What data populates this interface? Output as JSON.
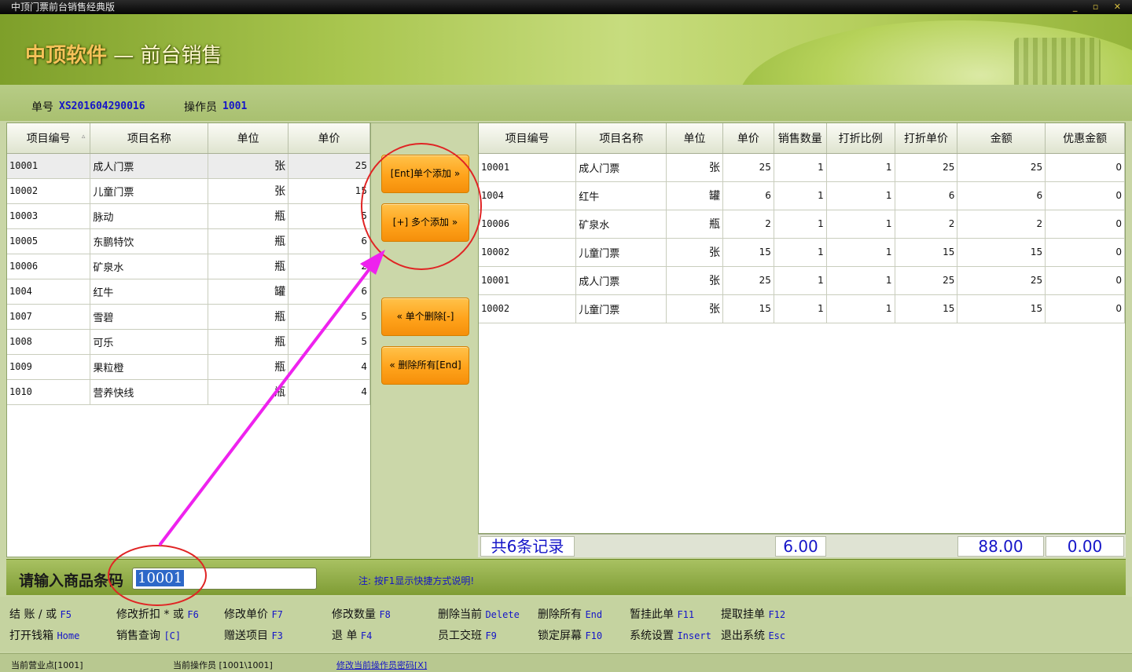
{
  "window": {
    "title": "中顶门票前台销售经典版",
    "controls": "_ ▫ ✕"
  },
  "banner": {
    "brand": "中顶软件",
    "dash": " — ",
    "subtitle": "前台销售"
  },
  "info": {
    "order_label": "单号",
    "order_no": "XS201604290016",
    "operator_label": "操作员",
    "operator_no": "1001"
  },
  "product_table": {
    "headers": [
      "项目编号",
      "项目名称",
      "单位",
      "单价"
    ],
    "rows": [
      [
        "10001",
        "成人门票",
        "张",
        "25"
      ],
      [
        "10002",
        "儿童门票",
        "张",
        "15"
      ],
      [
        "10003",
        "脉动",
        "瓶",
        "5"
      ],
      [
        "10005",
        "东鹏特饮",
        "瓶",
        "6"
      ],
      [
        "10006",
        "矿泉水",
        "瓶",
        "2"
      ],
      [
        "1004",
        "红牛",
        "罐",
        "6"
      ],
      [
        "1007",
        "雪碧",
        "瓶",
        "5"
      ],
      [
        "1008",
        "可乐",
        "瓶",
        "5"
      ],
      [
        "1009",
        "果粒橙",
        "瓶",
        "4"
      ],
      [
        "1010",
        "营养快线",
        "瓶",
        "4"
      ]
    ]
  },
  "buttons": {
    "add_one": "[Ent]单个添加 »",
    "add_multi": "[+] 多个添加 »",
    "delete_one": "« 单个删除[-]",
    "delete_all": "« 删除所有[End]"
  },
  "sale_table": {
    "headers": [
      "项目编号",
      "项目名称",
      "单位",
      "单价",
      "销售数量",
      "打折比例",
      "打折单价",
      "金额",
      "优惠金额"
    ],
    "rows": [
      [
        "10001",
        "成人门票",
        "张",
        "25",
        "1",
        "1",
        "25",
        "25",
        "0"
      ],
      [
        "1004",
        "红牛",
        "罐",
        "6",
        "1",
        "1",
        "6",
        "6",
        "0"
      ],
      [
        "10006",
        "矿泉水",
        "瓶",
        "2",
        "1",
        "1",
        "2",
        "2",
        "0"
      ],
      [
        "10002",
        "儿童门票",
        "张",
        "15",
        "1",
        "1",
        "15",
        "15",
        "0"
      ],
      [
        "10001",
        "成人门票",
        "张",
        "25",
        "1",
        "1",
        "25",
        "25",
        "0"
      ],
      [
        "10002",
        "儿童门票",
        "张",
        "15",
        "1",
        "1",
        "15",
        "15",
        "0"
      ]
    ]
  },
  "summary": {
    "record_count": "共6条记录",
    "total_qty": "6.00",
    "total_amount": "88.00",
    "total_discount": "0.00"
  },
  "input": {
    "label": "请输入商品条码",
    "value": "10001",
    "hint": "注: 按F1显示快捷方式说明!"
  },
  "shortcuts": [
    {
      "label": "结  账 / 或",
      "key": "F5"
    },
    {
      "label": "修改折扣 * 或",
      "key": "F6"
    },
    {
      "label": "修改单价",
      "key": "F7"
    },
    {
      "label": "修改数量",
      "key": "F8"
    },
    {
      "label": "删除当前",
      "key": "Delete"
    },
    {
      "label": "删除所有",
      "key": "End"
    },
    {
      "label": "暂挂此单",
      "key": "F11"
    },
    {
      "label": "提取挂单",
      "key": "F12"
    },
    {
      "label": "打开钱箱",
      "key": "Home"
    },
    {
      "label": "销售查询",
      "key": "[C]"
    },
    {
      "label": "赠送项目",
      "key": "F3"
    },
    {
      "label": "退    单",
      "key": "F4"
    },
    {
      "label": "员工交班",
      "key": "F9"
    },
    {
      "label": "锁定屏幕",
      "key": "F10"
    },
    {
      "label": "系统设置",
      "key": "Insert"
    },
    {
      "label": "退出系统",
      "key": "Esc"
    }
  ],
  "status": {
    "business_point": "当前营业点[1001]",
    "current_operator": "当前操作员 [1001\\1001]",
    "change_password": "修改当前操作员密码[X]"
  },
  "colors": {
    "accent_blue": "#1515c8",
    "button_orange": "#ffa31b",
    "annotation_magenta": "#ee22ee",
    "annotation_red": "#e02424"
  }
}
